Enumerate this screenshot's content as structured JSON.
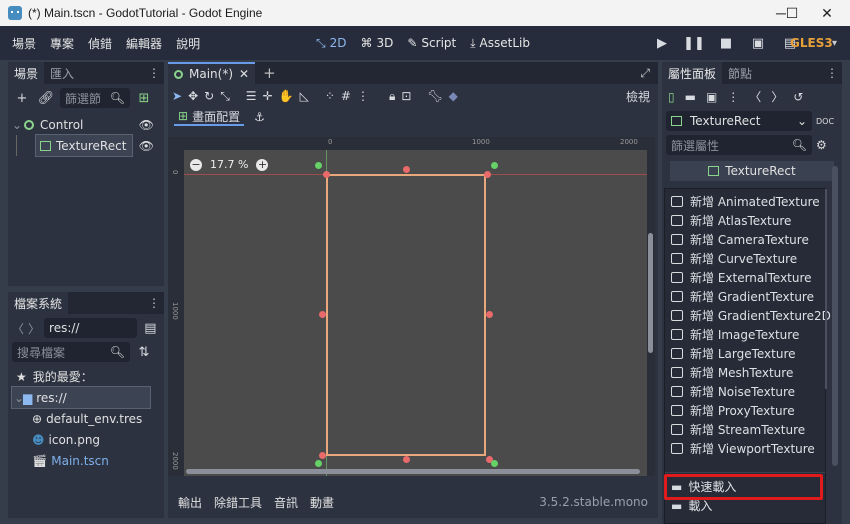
{
  "window": {
    "title": "(*) Main.tscn - GodotTutorial - Godot Engine",
    "minimize": "─",
    "maximize": "☐",
    "close": "✕"
  },
  "menubar": {
    "menus": [
      "場景",
      "專案",
      "偵錯",
      "編輯器",
      "說明"
    ],
    "workspaces": [
      {
        "label": "2D",
        "icon": "2d-icon",
        "active": true
      },
      {
        "label": "3D",
        "icon": "3d-icon"
      },
      {
        "label": "Script",
        "icon": "script-icon"
      },
      {
        "label": "AssetLib",
        "icon": "assetlib-icon"
      }
    ],
    "renderer": "GLES3"
  },
  "scene_dock": {
    "tabs": [
      "場景",
      "匯入"
    ],
    "filter_placeholder": "篩選節",
    "tree": [
      {
        "label": "Control",
        "depth": 0
      },
      {
        "label": "TextureRect",
        "depth": 1
      }
    ]
  },
  "filesystem_dock": {
    "tab": "檔案系統",
    "path": "res://",
    "search_placeholder": "搜尋檔案",
    "favorites_label": "我的最愛：",
    "items": [
      {
        "label": "res://",
        "type": "folder"
      },
      {
        "label": "default_env.tres",
        "type": "env"
      },
      {
        "label": "icon.png",
        "type": "image"
      },
      {
        "label": "Main.tscn",
        "type": "scene"
      }
    ]
  },
  "editor": {
    "tab": "Main(*)",
    "layout_button": "畫面配置",
    "view_button": "檢視",
    "zoom": "17.7 %",
    "ruler_h": [
      "0",
      "1000",
      "2000"
    ],
    "ruler_v": [
      "0",
      "1000",
      "2000"
    ]
  },
  "bottom_panel": {
    "tabs": [
      "輸出",
      "除錯工具",
      "音訊",
      "動畫"
    ],
    "version": "3.5.2.stable.mono"
  },
  "inspector": {
    "tabs": [
      "屬性面板",
      "節點"
    ],
    "object": "TextureRect",
    "filter_placeholder": "篩選屬性",
    "texture_header": "TextureRect"
  },
  "popup_menu": {
    "items": [
      "新增 AnimatedTexture",
      "新增 AtlasTexture",
      "新增 CameraTexture",
      "新增 CurveTexture",
      "新增 ExternalTexture",
      "新增 GradientTexture",
      "新增 GradientTexture2D",
      "新增 ImageTexture",
      "新增 LargeTexture",
      "新增 MeshTexture",
      "新增 NoiseTexture",
      "新增 ProxyTexture",
      "新增 StreamTexture",
      "新增 ViewportTexture"
    ],
    "quick_load": "快速載入",
    "load": "載入",
    "highlight_color": "#e01b1b"
  }
}
